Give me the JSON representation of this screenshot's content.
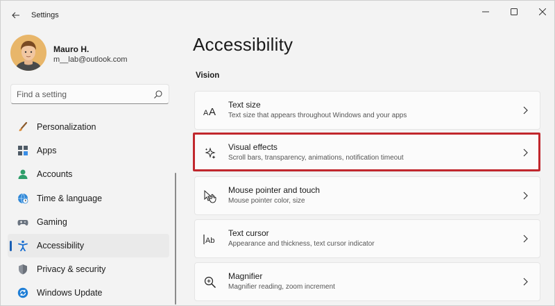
{
  "window": {
    "title": "Settings"
  },
  "user": {
    "name": "Mauro H.",
    "email": "m__lab@outlook.com"
  },
  "search": {
    "placeholder": "Find a setting"
  },
  "nav": {
    "items": [
      {
        "label": "Personalization",
        "icon": "brush-icon"
      },
      {
        "label": "Apps",
        "icon": "apps-icon"
      },
      {
        "label": "Accounts",
        "icon": "person-icon"
      },
      {
        "label": "Time & language",
        "icon": "globe-clock-icon"
      },
      {
        "label": "Gaming",
        "icon": "gamepad-icon"
      },
      {
        "label": "Accessibility",
        "icon": "accessibility-icon",
        "active": true
      },
      {
        "label": "Privacy & security",
        "icon": "shield-icon"
      },
      {
        "label": "Windows Update",
        "icon": "update-icon"
      }
    ]
  },
  "main": {
    "title": "Accessibility",
    "section": "Vision",
    "cards": [
      {
        "title": "Text size",
        "desc": "Text size that appears throughout Windows and your apps",
        "icon": "text-size-icon"
      },
      {
        "title": "Visual effects",
        "desc": "Scroll bars, transparency, animations, notification timeout",
        "icon": "sparkle-icon",
        "highlighted": true
      },
      {
        "title": "Mouse pointer and touch",
        "desc": "Mouse pointer color, size",
        "icon": "pointer-touch-icon"
      },
      {
        "title": "Text cursor",
        "desc": "Appearance and thickness, text cursor indicator",
        "icon": "text-cursor-icon"
      },
      {
        "title": "Magnifier",
        "desc": "Magnifier reading, zoom increment",
        "icon": "magnifier-icon"
      }
    ]
  },
  "colors": {
    "accent": "#1a5fb4",
    "highlight": "#c1272d"
  }
}
